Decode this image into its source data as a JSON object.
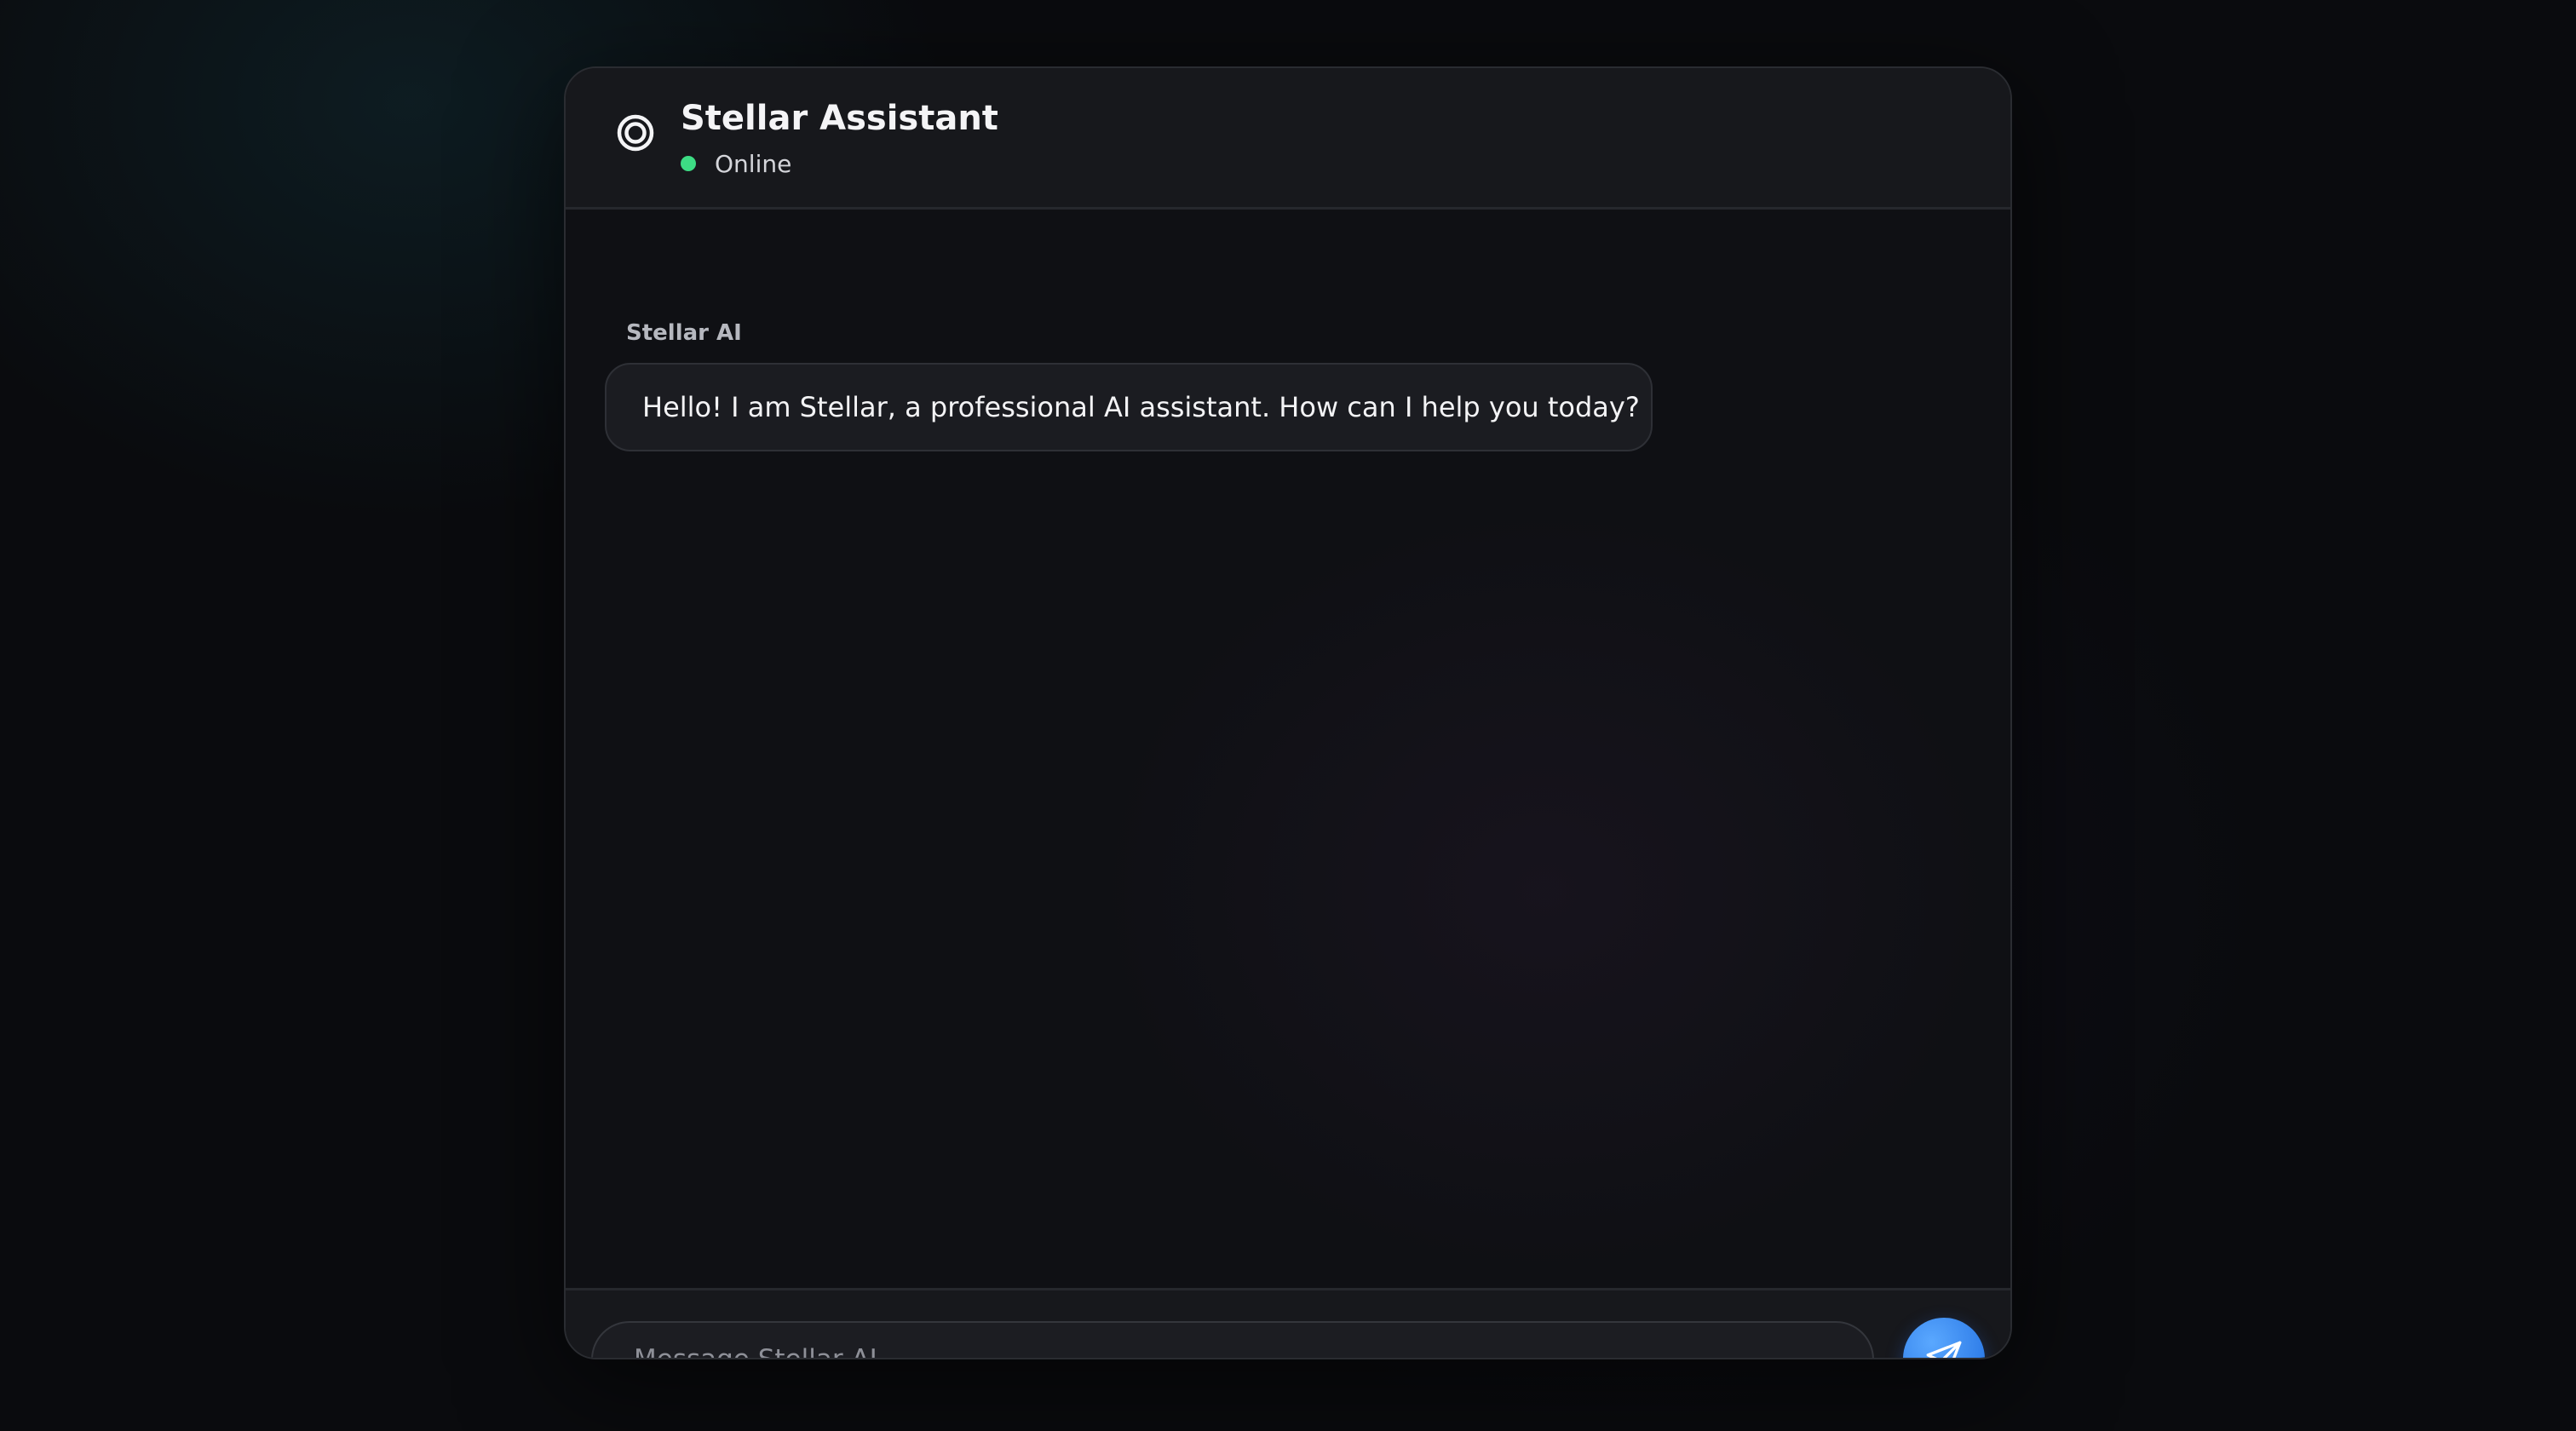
{
  "header": {
    "title": "Stellar Assistant",
    "status": "Online",
    "logo_icon": "concentric-circles-icon",
    "status_color": "#3ddc84"
  },
  "messages": [
    {
      "sender": "Stellar AI",
      "text": "Hello! I am Stellar, a professional AI assistant. How can I help you today?"
    }
  ],
  "composer": {
    "placeholder": "Message Stellar AI...",
    "value": "",
    "send_icon": "paper-plane-icon",
    "accent_color": "#3d8cf0"
  }
}
